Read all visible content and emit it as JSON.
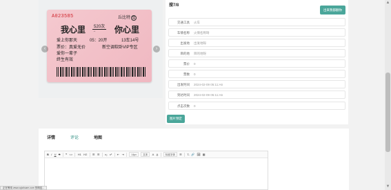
{
  "ticket": {
    "serial": "A023585",
    "checkin": "丘比特",
    "checkin_badge": "售",
    "from": "我心里",
    "train": "520次",
    "to": "你心里",
    "arrow": "→",
    "line1_left": "爱上你那天",
    "line1_mid": "05：20开",
    "line1_right": "13车14号",
    "line2_left": "票价：真爱无价",
    "line2_right": "新空调软卧VIP专区",
    "line3": "爱你一辈子",
    "line4": "终生有效",
    "prev": "‹",
    "next": "›"
  },
  "form": {
    "heading": "搜7/8",
    "top_action": "出来我都翻你",
    "rows": [
      {
        "label": "交通工具",
        "value": "火车"
      },
      {
        "label": "车情名称",
        "value": "火情名称呀"
      },
      {
        "label": "出发地",
        "value": "出发地呀"
      },
      {
        "label": "目的地",
        "value": "目的地呀"
      },
      {
        "label": "票价",
        "value": "0"
      },
      {
        "label": "票数",
        "value": "0"
      },
      {
        "label": "出发时间",
        "value": "2024-02-09 05:11:A6"
      },
      {
        "label": "到达时间",
        "value": "2024-02-09 05:11:A6"
      },
      {
        "label": "点击次数",
        "value": "0"
      }
    ],
    "submit": "图片预定"
  },
  "tabs": [
    {
      "label": "详情",
      "active": false
    },
    {
      "label": "评论",
      "active": true
    },
    {
      "label": "地图",
      "active": false
    }
  ],
  "editor": {
    "toolbar": [
      "B",
      "I",
      "U",
      "S",
      "|",
      "❝",
      "<>",
      "|",
      "H1",
      "H2",
      "|",
      "☰",
      "☰",
      "|",
      "x₂",
      "x²",
      "|",
      "⇤",
      "⇥",
      "|"
    ],
    "size_select": "14px",
    "font_select": "文本",
    "toolbar2": [
      "A",
      "A̲",
      "|"
    ],
    "font_family_select": "标准字体",
    "toolbar3": [
      "☰",
      "|",
      "T̶",
      "🔗",
      "🖼",
      "▦"
    ]
  },
  "status_bar": "正在等待 www.cqiahuzm.com 的响应..."
}
